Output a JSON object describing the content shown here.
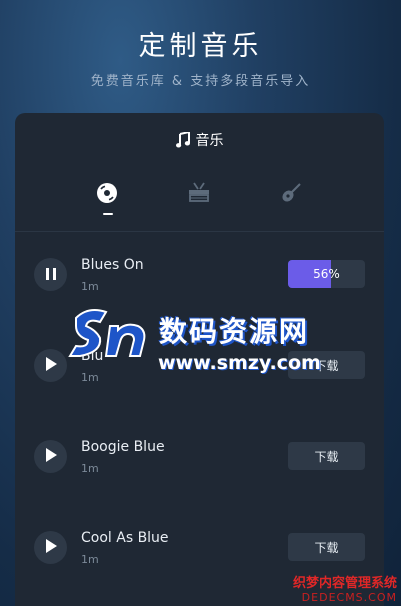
{
  "hero": {
    "title": "定制音乐",
    "subtitle": "免费音乐库 & 支持多段音乐导入"
  },
  "card": {
    "header": "音乐",
    "tabs": [
      {
        "icon": "vinyl-disc-icon",
        "active": true
      },
      {
        "icon": "drum-icon",
        "active": false
      },
      {
        "icon": "guitar-icon",
        "active": false
      }
    ]
  },
  "tracks": [
    {
      "title": "Blues On",
      "duration": "1m",
      "state": "playing",
      "progress": 0.56,
      "progress_label": "56%"
    },
    {
      "title": "Blu",
      "duration": "1m",
      "state": "paused",
      "action_label": "下载"
    },
    {
      "title": "Boogie Blue",
      "duration": "1m",
      "state": "paused",
      "action_label": "下载"
    },
    {
      "title": "Cool As Blue",
      "duration": "1m",
      "state": "paused",
      "action_label": "下载"
    }
  ],
  "watermark": {
    "name": "数码资源网",
    "url": "www.smzy.com"
  },
  "corner_watermark": {
    "name": "织梦内容管理系统",
    "url": "DEDECMS.COM"
  },
  "colors": {
    "accent": "#6b5ce8",
    "card": "#1f2834",
    "button": "#2e3947"
  }
}
